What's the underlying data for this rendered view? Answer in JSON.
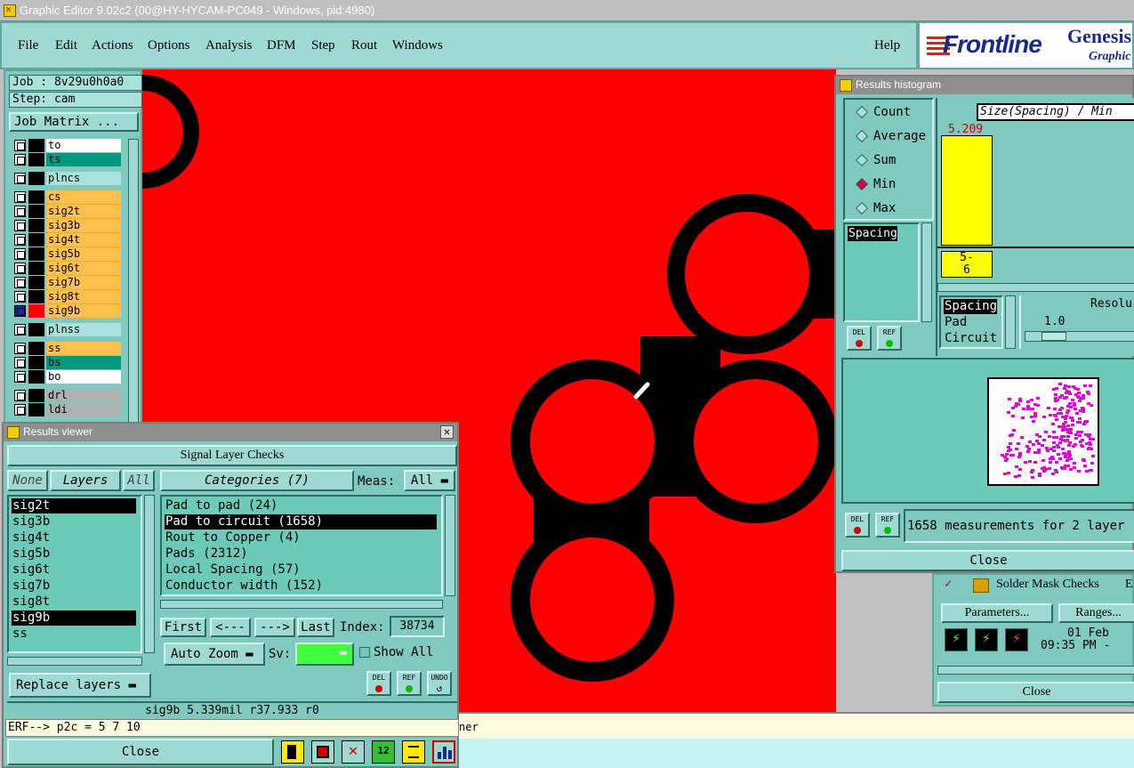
{
  "title_bar": {
    "text": "Graphic Editor 9.02c2 (00@HY-HYCAM-PC049 - Windows, pid:4980)"
  },
  "menu": {
    "items": [
      "File",
      "Edit",
      "Actions",
      "Options",
      "Analysis",
      "DFM",
      "Step",
      "Rout",
      "Windows"
    ],
    "help": "Help"
  },
  "logo": {
    "brand": "Frontline",
    "product": "Genesis",
    "subtitle": "Graphic"
  },
  "left_panel": {
    "job": "Job : 8v29u0h0a0",
    "step": "Step: cam",
    "job_matrix": "Job Matrix ...",
    "layers": [
      {
        "name": "to",
        "color": "#ffffff"
      },
      {
        "name": "ts",
        "color": "#009980"
      },
      {
        "name": "plncs",
        "color": "#a9e2da"
      },
      {
        "name": "cs",
        "color": "#ffc04c"
      },
      {
        "name": "sig2t",
        "color": "#ffc04c"
      },
      {
        "name": "sig3b",
        "color": "#ffc04c"
      },
      {
        "name": "sig4t",
        "color": "#ffc04c"
      },
      {
        "name": "sig5b",
        "color": "#ffc04c"
      },
      {
        "name": "sig6t",
        "color": "#ffc04c"
      },
      {
        "name": "sig7b",
        "color": "#ffc04c"
      },
      {
        "name": "sig8t",
        "color": "#ffc04c"
      },
      {
        "name": "sig9b",
        "color": "#ffc04c"
      },
      {
        "name": "plnss",
        "color": "#a9e2da"
      },
      {
        "name": "ss",
        "color": "#ffc04c"
      },
      {
        "name": "bs",
        "color": "#009980"
      },
      {
        "name": "bo",
        "color": "#ffffff"
      },
      {
        "name": "drl",
        "color": "#b0b0b0"
      },
      {
        "name": "ldi",
        "color": "#b0b0b0"
      }
    ]
  },
  "histogram": {
    "title": "Results histogram",
    "modes": [
      "Count",
      "Average",
      "Sum",
      "Min",
      "Max"
    ],
    "selected_mode": "Min",
    "measure_list": [
      "Spacing"
    ],
    "header": "Size(Spacing) / Min",
    "bar_value": "5.209",
    "bar_range_top": "5-",
    "bar_range_bottom": "6",
    "types": [
      "Spacing",
      "Pad",
      "Circuit"
    ],
    "resolution_label": "Resolu",
    "resolution_value": "1.0",
    "del_label": "DEL",
    "ref_label": "REF",
    "measurements_text": "1658 measurements for 2 layer",
    "close": "Close"
  },
  "checks_panel": {
    "item": "Solder Mask Checks",
    "item_suffix": "E",
    "parameters": "Parameters...",
    "ranges": "Ranges...",
    "date": "01 Feb",
    "time": "09:35 PM -",
    "close": "Close"
  },
  "viewer": {
    "title": "Results viewer",
    "header": "Signal Layer Checks",
    "none": "None",
    "layers_label": "Layers",
    "all": "All",
    "layer_list": [
      "sig2t",
      "sig3b",
      "sig4t",
      "sig5b",
      "sig6t",
      "sig7b",
      "sig8t",
      "sig9b",
      "ss"
    ],
    "selected_layers": [
      "sig2t",
      "sig9b"
    ],
    "categories_label": "Categories (7)",
    "meas_label": "Meas:",
    "meas_value": "All",
    "categories": [
      "Pad to pad (24)",
      "Pad to circuit (1658)",
      "Rout to Copper (4)",
      "Pads (2312)",
      "Local Spacing (57)",
      "Conductor width (152)"
    ],
    "selected_category": "Pad to circuit (1658)",
    "first": "First",
    "prev": "<---",
    "next": "--->",
    "last": "Last",
    "index_label": "Index:",
    "index_value": "38734",
    "auto_zoom": "Auto Zoom",
    "sv_label": "Sv:",
    "show_all": "Show All",
    "replace_layers": "Replace layers",
    "del": "DEL",
    "ref": "REF",
    "undo": "UNDO",
    "status": "sig9b 5.339mil  r37.933  r0",
    "erf": "ERF--> p2c = 5 7 10",
    "close": "Close"
  },
  "command_line": {
    "text": "ner"
  },
  "colors": {
    "canvas": "#ff0000",
    "panel": "#7fc9bf",
    "list": "#6ccab8",
    "highlight_bar": "#ffff00"
  }
}
